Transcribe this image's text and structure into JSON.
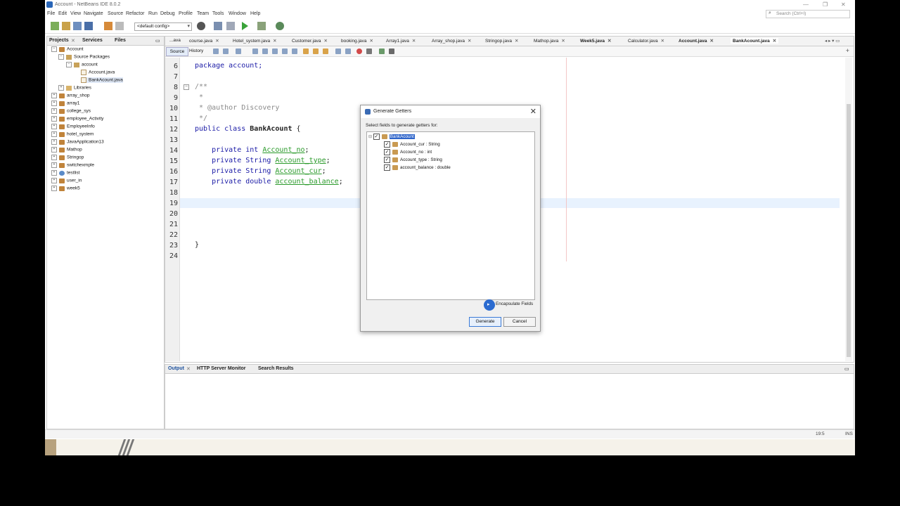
{
  "window": {
    "title": "Account - NetBeans IDE 8.0.2"
  },
  "menubar": [
    "File",
    "Edit",
    "View",
    "Navigate",
    "Source",
    "Refactor",
    "Run",
    "Debug",
    "Profile",
    "Team",
    "Tools",
    "Window",
    "Help"
  ],
  "search": {
    "placeholder": "Search (Ctrl+I)"
  },
  "toolbar": {
    "config": "<default config>"
  },
  "panel_tabs": [
    "Projects",
    "Services",
    "Files"
  ],
  "tree": [
    {
      "label": "Account",
      "level": 0
    },
    {
      "label": "Source Packages",
      "level": 1
    },
    {
      "label": "account",
      "level": 2
    },
    {
      "label": "Account.java",
      "level": 3
    },
    {
      "label": "BankAcount.java",
      "level": 3
    },
    {
      "label": "Libraries",
      "level": 1
    },
    {
      "label": "array_shop",
      "level": 0
    },
    {
      "label": "array1",
      "level": 0
    },
    {
      "label": "college_sys",
      "level": 0
    },
    {
      "label": "employee_Activity",
      "level": 0
    },
    {
      "label": "EmployeeInfo",
      "level": 0
    },
    {
      "label": "hotel_system",
      "level": 0
    },
    {
      "label": "JavaApplication13",
      "level": 0
    },
    {
      "label": "Mathop",
      "level": 0
    },
    {
      "label": "Stringop",
      "level": 0
    },
    {
      "label": "switchexmple",
      "level": 0
    },
    {
      "label": "testlist",
      "level": 0
    },
    {
      "label": "user_in",
      "level": 0
    },
    {
      "label": "week5",
      "level": 0
    }
  ],
  "file_tabs": [
    "...ava",
    "course.java",
    "Hotel_system.java",
    "Customer.java",
    "booking.java",
    "Array1.java",
    "Array_shop.java",
    "Stringop.java",
    "Mathop.java",
    "Week5.java",
    "Calculator.java",
    "Account.java",
    "BankAcount.java"
  ],
  "editor_tabs": {
    "source": "Source",
    "history": "History"
  },
  "code": {
    "line_numbers": [
      "6",
      "7",
      "8",
      "9",
      "10",
      "11",
      "12",
      "13",
      "14",
      "15",
      "16",
      "17",
      "18",
      "19",
      "20",
      "21",
      "22",
      "23",
      "24"
    ],
    "l6": "package account;",
    "l8": "/**",
    "l9": " *",
    "l10": " * @author Discovery",
    "l11": " */",
    "l12a": "public class ",
    "l12b": "BankAcount",
    "l12c": " {",
    "l14a": "    private int ",
    "l14b": "Account_no",
    "l15a": "    private String ",
    "l15b": "Account_type",
    "l16a": "    private String ",
    "l16b": "Account_cur",
    "l17a": "    private double ",
    "l17b": "account_balance",
    "semi": ";",
    "l23": "}"
  },
  "output_tabs": [
    "Output",
    "HTTP Server Monitor",
    "Search Results"
  ],
  "status": {
    "position": "19:5",
    "mode": "INS"
  },
  "dialog": {
    "title": "Generate Getters",
    "prompt": "Select fields to generate getters for:",
    "root": "BankAcount",
    "fields": [
      "Account_cur : String",
      "Account_no : int",
      "Account_type : String",
      "account_balance : double"
    ],
    "encapsulate": "Encapsulate Fields",
    "generate": "Generate",
    "cancel": "Cancel"
  }
}
